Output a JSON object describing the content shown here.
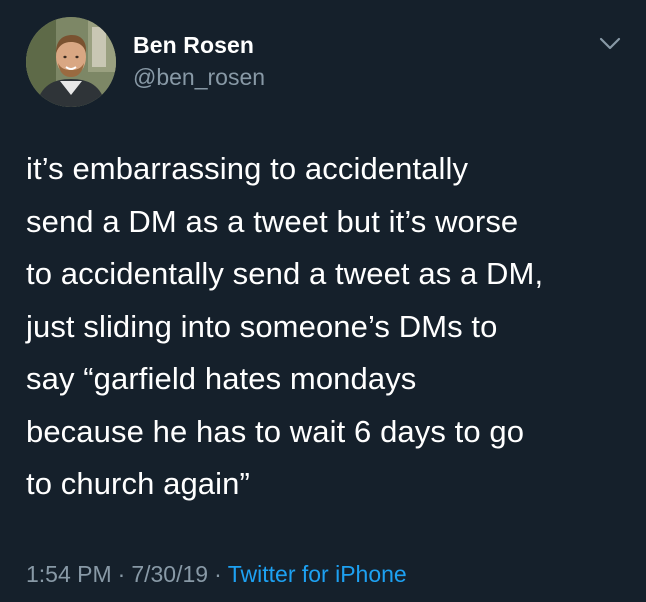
{
  "user": {
    "display_name": "Ben Rosen",
    "handle": "@ben_rosen"
  },
  "tweet": {
    "text": "it’s embarrassing to accidentally\nsend a DM as a tweet but it’s worse\nto accidentally send a tweet as a DM,\njust sliding into someone’s DMs to\nsay “garfield hates mondays\nbecause he has to wait 6 days to go\nto church again”"
  },
  "meta": {
    "time": "1:54 PM",
    "date": "7/30/19",
    "separator": "·",
    "source": "Twitter for iPhone"
  },
  "icons": {
    "menu": "chevron-down-icon",
    "avatar": "profile-photo"
  },
  "colors": {
    "background": "#15202b",
    "primary_text": "#ffffff",
    "secondary_text": "#8899a6",
    "link": "#1da1f2"
  }
}
